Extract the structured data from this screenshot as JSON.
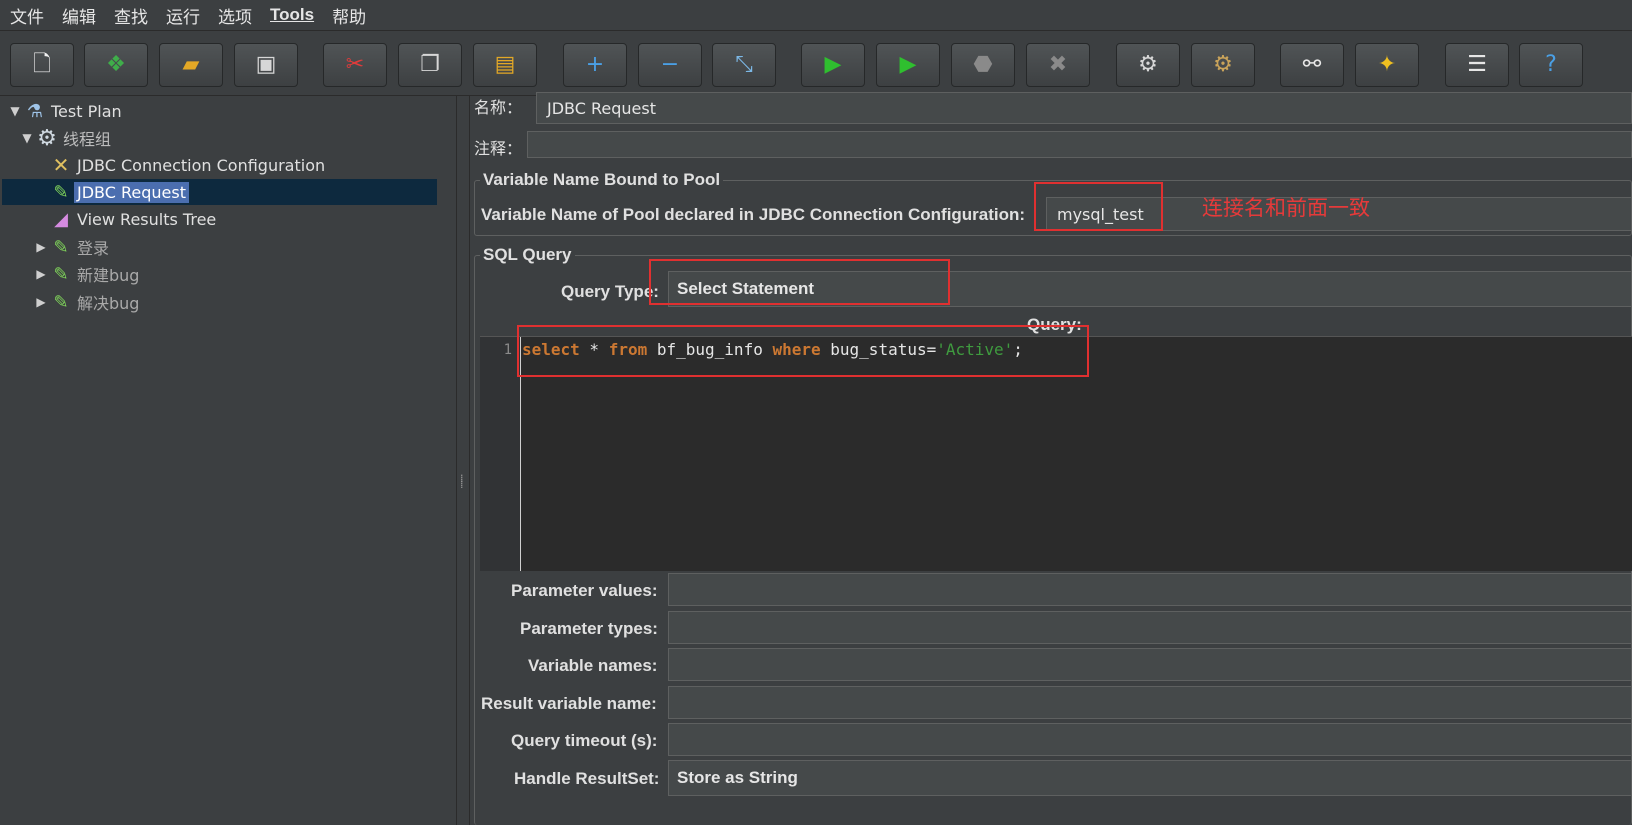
{
  "menu": [
    "文件",
    "编辑",
    "查找",
    "运行",
    "选项",
    "Tools",
    "帮助"
  ],
  "toolbar": {
    "buttons": [
      {
        "name": "new-icon",
        "glyph": "🗋",
        "color": "#f2f2f2"
      },
      {
        "name": "templates-icon",
        "glyph": "❖",
        "color": "#3fae4a"
      },
      {
        "name": "open-icon",
        "glyph": "▰",
        "color": "#e3a826"
      },
      {
        "name": "save-icon",
        "glyph": "▣",
        "color": "#d7d7d7"
      },
      {
        "name": "cut-icon",
        "glyph": "✂",
        "color": "#e23b3b"
      },
      {
        "name": "copy-icon",
        "glyph": "❐",
        "color": "#d7d7d7"
      },
      {
        "name": "paste-icon",
        "glyph": "▤",
        "color": "#e3a826"
      },
      {
        "name": "expand-icon",
        "glyph": "+",
        "color": "#4aa0e6"
      },
      {
        "name": "collapse-icon",
        "glyph": "−",
        "color": "#4aa0e6"
      },
      {
        "name": "toggle-icon",
        "glyph": "⤡",
        "color": "#7cb8e6"
      },
      {
        "name": "start-icon",
        "glyph": "▶",
        "color": "#2fbf2f"
      },
      {
        "name": "start-no-pauses-icon",
        "glyph": "▶",
        "color": "#2fbf2f"
      },
      {
        "name": "stop-icon",
        "glyph": "⬣",
        "color": "#8a8a8a"
      },
      {
        "name": "shutdown-icon",
        "glyph": "✖",
        "color": "#8a8a8a"
      },
      {
        "name": "clear-icon",
        "glyph": "⚙",
        "color": "#d7d7d7"
      },
      {
        "name": "clear-all-icon",
        "glyph": "⚙",
        "color": "#c9a35a"
      },
      {
        "name": "search-icon",
        "glyph": "⚯",
        "color": "#e6e6e6"
      },
      {
        "name": "reset-search-icon",
        "glyph": "✦",
        "color": "#f0c020"
      },
      {
        "name": "function-helper-icon",
        "glyph": "☰",
        "color": "#e6e6e6"
      },
      {
        "name": "help-icon",
        "glyph": "?",
        "color": "#4aa0e6"
      }
    ]
  },
  "tree": {
    "items": [
      {
        "label": "Test Plan",
        "icon": "flask-icon",
        "glyph": "⚗"
      },
      {
        "label": "线程组",
        "icon": "gear-icon",
        "glyph": "⚙"
      },
      {
        "label": "JDBC Connection Configuration",
        "icon": "config-tools-icon",
        "glyph": "✕"
      },
      {
        "label": "JDBC Request",
        "icon": "sampler-pipette-icon",
        "glyph": "✎"
      },
      {
        "label": "View Results Tree",
        "icon": "listener-chart-icon",
        "glyph": "◢"
      },
      {
        "label": "登录",
        "icon": "sampler-pipette-icon",
        "glyph": "✎"
      },
      {
        "label": "新建bug",
        "icon": "sampler-pipette-icon",
        "glyph": "✎"
      },
      {
        "label": "解决bug",
        "icon": "sampler-pipette-icon",
        "glyph": "✎"
      }
    ]
  },
  "form": {
    "name_label": "名称：",
    "name_value": "JDBC Request",
    "comment_label": "注释：",
    "comment_value": ""
  },
  "pool": {
    "legend": "Variable Name Bound to Pool",
    "label": "Variable Name of Pool declared in JDBC Connection Configuration:",
    "value": "mysql_test",
    "annotation": "连接名和前面一致"
  },
  "sql": {
    "legend": "SQL Query",
    "query_type_label": "Query Type:",
    "query_type_value": "Select Statement",
    "query_label": "Query:",
    "line_number": "1",
    "code": {
      "t1": "select",
      "t2": " * ",
      "t3": "from",
      "t4": " bf_bug_info ",
      "t5": "where",
      "t6": " bug_status=",
      "t7": "'Active'",
      "t8": ";"
    }
  },
  "params": [
    {
      "label": "Parameter values:",
      "value": ""
    },
    {
      "label": "Parameter types:",
      "value": ""
    },
    {
      "label": "Variable names:",
      "value": ""
    },
    {
      "label": "Result variable name:",
      "value": ""
    },
    {
      "label": "Query timeout (s):",
      "value": ""
    },
    {
      "label": "Handle ResultSet:",
      "value": "Store as String"
    }
  ],
  "colors": {
    "annotation_red": "#e03030",
    "keyword": "#cc7832",
    "string": "#3f9b3f",
    "selection": "#4b6eaf"
  }
}
